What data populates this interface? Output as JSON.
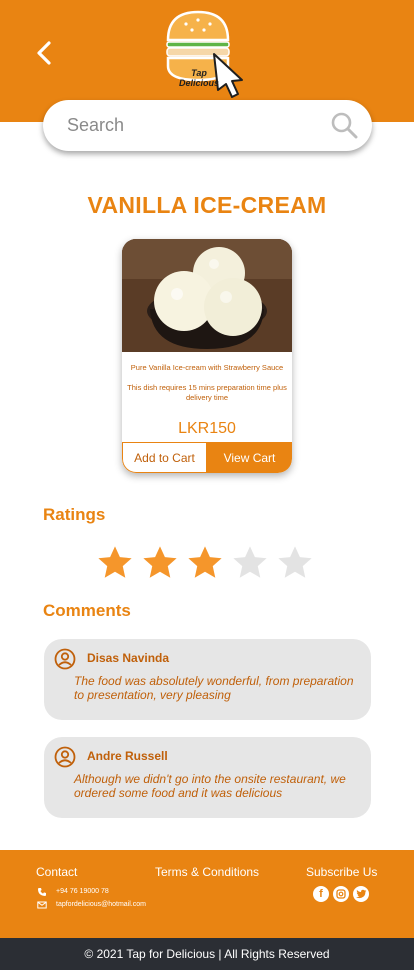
{
  "header": {
    "back_icon": "chevron-left-icon",
    "logo": {
      "text_line1": "Tap",
      "text_line2": "Delicious"
    }
  },
  "search": {
    "placeholder": "Search",
    "value": ""
  },
  "product": {
    "title": "VANILLA ICE-CREAM",
    "description": "Pure Vanilla Ice-cream with Strawberry Sauce",
    "note": "This dish requires 15 mins preparation time plus delivery time",
    "price": "LKR150",
    "add_to_cart_label": "Add to Cart",
    "view_cart_label": "View Cart"
  },
  "ratings": {
    "heading": "Ratings",
    "value": 3,
    "max": 5
  },
  "comments": {
    "heading": "Comments",
    "items": [
      {
        "name": "Disas Navinda",
        "text": "The food was absolutely wonderful, from preparation to presentation, very pleasing"
      },
      {
        "name": "Andre Russell",
        "text": "Although we didn't go into the onsite restaurant, we ordered some food and it was delicious"
      }
    ]
  },
  "footer": {
    "contact_label": "Contact",
    "terms_label": "Terms & Conditions",
    "subscribe_label": "Subscribe Us",
    "phone": "+94 76 19000 78",
    "email": "tapfordelicious@hotmail.com",
    "social_icons": [
      "facebook-icon",
      "instagram-icon",
      "twitter-icon"
    ]
  },
  "copyright": "© 2021 Tap for Delicious | All Rights Reserved",
  "colors": {
    "accent": "#e98412",
    "text_accent": "#c0600a",
    "footer_bottom": "#2b2e34",
    "star_filled": "#f5962b",
    "star_empty": "#e3e3e3"
  }
}
